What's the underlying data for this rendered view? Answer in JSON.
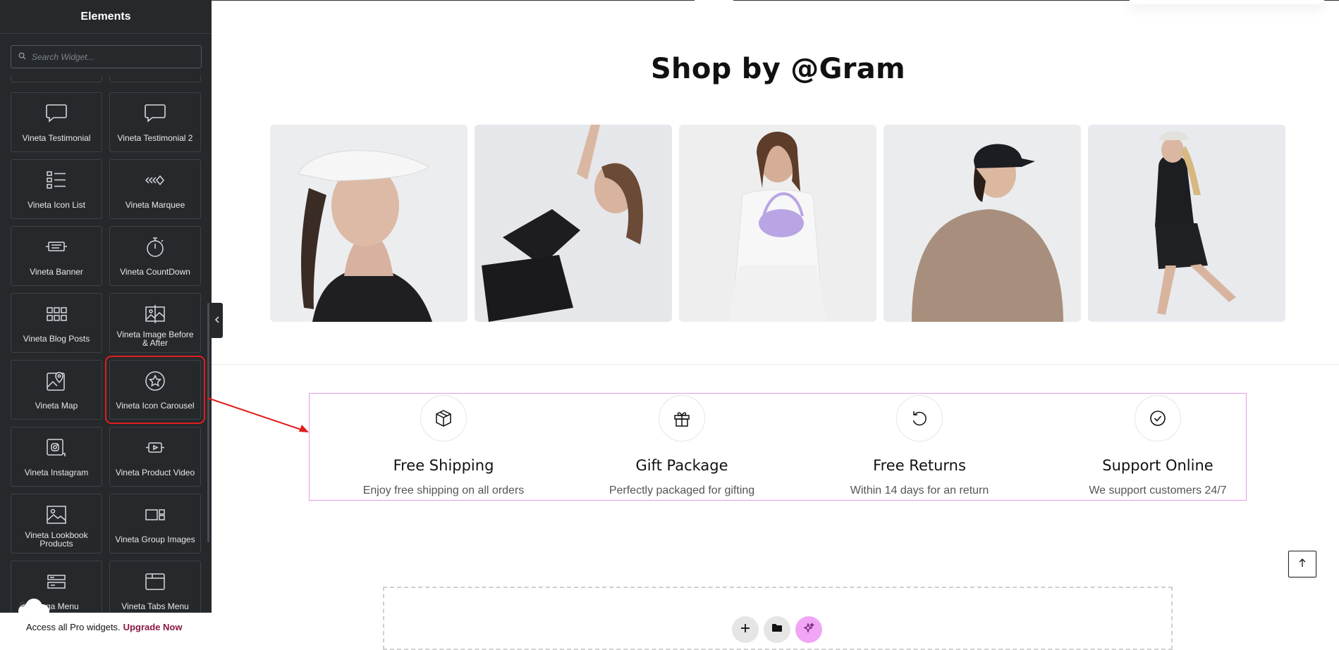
{
  "sidebar": {
    "title": "Elements",
    "search_placeholder": "Search Widget...",
    "widgets": [
      {
        "label": "Vineta Testimonial",
        "icon": "speech-bubble-icon"
      },
      {
        "label": "Vineta Testimonial 2",
        "icon": "speech-bubble-icon"
      },
      {
        "label": "Vineta Icon List",
        "icon": "icon-list-icon"
      },
      {
        "label": "Vineta Marquee",
        "icon": "marquee-icon"
      },
      {
        "label": "Vineta Banner",
        "icon": "banner-icon"
      },
      {
        "label": "Vineta CountDown",
        "icon": "stopwatch-icon"
      },
      {
        "label": "Vineta Blog Posts",
        "icon": "grid-posts-icon"
      },
      {
        "label": "Vineta Image Before & After",
        "icon": "image-compare-icon"
      },
      {
        "label": "Vineta Map",
        "icon": "map-pin-icon"
      },
      {
        "label": "Vineta Icon Carousel",
        "icon": "star-circle-icon"
      },
      {
        "label": "Vineta Instagram",
        "icon": "instagram-icon"
      },
      {
        "label": "Vineta Product Video",
        "icon": "video-icon"
      },
      {
        "label": "Vineta Lookbook Products",
        "icon": "image-icon"
      },
      {
        "label": "Vineta Group Images",
        "icon": "group-images-icon"
      },
      {
        "label": "Mega Menu",
        "icon": "mega-menu-icon"
      },
      {
        "label": "Vineta Tabs Menu",
        "icon": "tabs-menu-icon"
      }
    ],
    "promo": {
      "text": "Access all Pro widgets.",
      "link": "Upgrade Now"
    }
  },
  "canvas": {
    "section_title": "Shop by @Gram",
    "gram_images": [
      "white-visor-woman",
      "black-tank-woman-stretching",
      "lavender-bag-woman",
      "black-cap-sweatshirt-woman",
      "running-woman"
    ],
    "features": [
      {
        "title": "Free Shipping",
        "desc": "Enjoy free shipping on all orders",
        "icon": "box-icon"
      },
      {
        "title": "Gift Package",
        "desc": "Perfectly packaged for gifting",
        "icon": "gift-icon"
      },
      {
        "title": "Free Returns",
        "desc": "Within 14 days for an return",
        "icon": "return-arrow-icon"
      },
      {
        "title": "Support Online",
        "desc": "We support customers 24/7",
        "icon": "check-circle-icon"
      }
    ]
  },
  "colors": {
    "sidebar_bg": "#26292c",
    "highlight_red": "#e11d1d",
    "feature_border": "#e59be8",
    "upgrade_link": "#8a1744",
    "ai_button": "#f0a6f5"
  }
}
